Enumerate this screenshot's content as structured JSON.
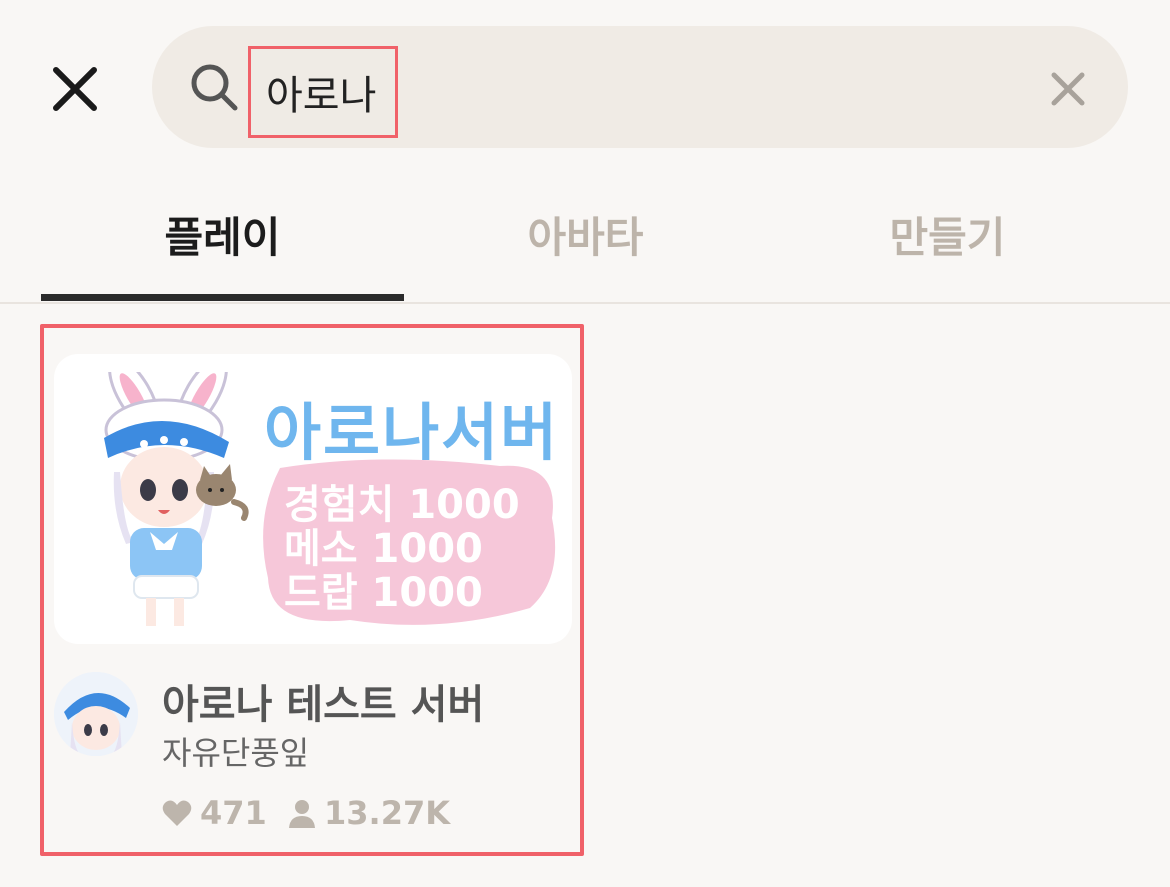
{
  "search": {
    "query": "아로나"
  },
  "tabs": [
    {
      "label": "플레이",
      "active": true
    },
    {
      "label": "아바타",
      "active": false
    },
    {
      "label": "만들기",
      "active": false
    }
  ],
  "result": {
    "thumbnail": {
      "title": "아로나서버",
      "lines": [
        "경험치 1000",
        "메소 1000",
        "드랍 1000"
      ]
    },
    "title": "아로나 테스트 서버",
    "creator": "자유단풍잎",
    "likes": "471",
    "players": "13.27K"
  },
  "colors": {
    "highlight": "#f06169",
    "accent": "#6fb6ee",
    "muted": "#bdb5ac"
  }
}
